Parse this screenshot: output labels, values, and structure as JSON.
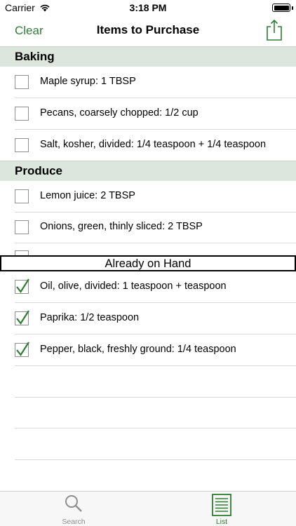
{
  "status_bar": {
    "carrier": "Carrier",
    "time": "3:18 PM"
  },
  "nav": {
    "left_button": "Clear",
    "title": "Items to Purchase",
    "share_icon": "share-icon"
  },
  "sections": [
    {
      "title": "Baking",
      "items": [
        {
          "label": "Maple syrup: 1 TBSP",
          "checked": false
        },
        {
          "label": "Pecans, coarsely chopped: 1/2 cup",
          "checked": false
        },
        {
          "label": "Salt, kosher, divided: 1/4 teaspoon + 1/4 teaspoon",
          "checked": false
        }
      ]
    },
    {
      "title": "Produce",
      "items": [
        {
          "label": "Lemon juice: 2 TBSP",
          "checked": false
        },
        {
          "label": "Onions, green, thinly sliced: 2 TBSP",
          "checked": false
        }
      ]
    }
  ],
  "already_on_hand": {
    "title": "Already on Hand",
    "items": [
      {
        "label": "Oil, olive, divided: 1 teaspoon +  teaspoon",
        "checked": true
      },
      {
        "label": "Paprika: 1/2 teaspoon",
        "checked": true
      },
      {
        "label": "Pepper, black, freshly ground: 1/4 teaspoon",
        "checked": true
      }
    ]
  },
  "tab_bar": {
    "tabs": [
      {
        "label": "Search",
        "icon": "search-icon",
        "selected": false
      },
      {
        "label": "List",
        "icon": "list-icon",
        "selected": true
      }
    ]
  },
  "colors": {
    "accent": "#2e7d32",
    "section_header_bg": "#dde6dc",
    "separator": "#d9d9d9",
    "tab_inactive": "#8e8e8e"
  }
}
